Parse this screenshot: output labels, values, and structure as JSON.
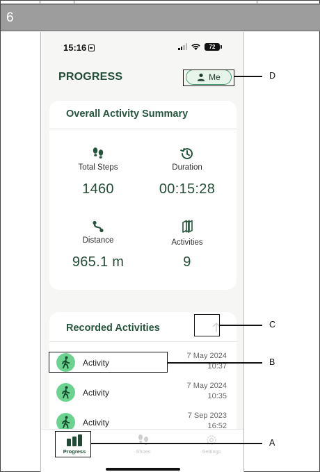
{
  "step_number": "6",
  "status_bar": {
    "time": "15:16",
    "battery": "72"
  },
  "header": {
    "title": "PROGRESS",
    "me_label": "Me"
  },
  "summary": {
    "title": "Overall Activity Summary",
    "stats": [
      {
        "label": "Total Steps",
        "value": "1460",
        "icon": "footprints-icon"
      },
      {
        "label": "Duration",
        "value": "00:15:28",
        "icon": "history-icon"
      },
      {
        "label": "Distance",
        "value": "965.1 m",
        "icon": "route-icon"
      },
      {
        "label": "Activities",
        "value": "9",
        "icon": "layers-icon"
      }
    ]
  },
  "recorded": {
    "title": "Recorded Activities",
    "items": [
      {
        "name": "Activity",
        "date": "7 May 2024",
        "time": "10:37"
      },
      {
        "name": "Activity",
        "date": "7 May 2024",
        "time": "10:35"
      },
      {
        "name": "Activity",
        "date": "7 Sep 2023",
        "time": "16:52"
      }
    ]
  },
  "tabs": [
    {
      "label": "Progress",
      "active": true
    },
    {
      "label": "Shoes",
      "active": false
    },
    {
      "label": "Settings",
      "active": false
    }
  ],
  "annotations": {
    "a": "A",
    "b": "B",
    "c": "C",
    "d": "D"
  },
  "colors": {
    "accent": "#25543c",
    "activity_avatar": "#6bd38f",
    "me_border": "#3f9b6a",
    "header_bar": "#9d9d9d"
  }
}
